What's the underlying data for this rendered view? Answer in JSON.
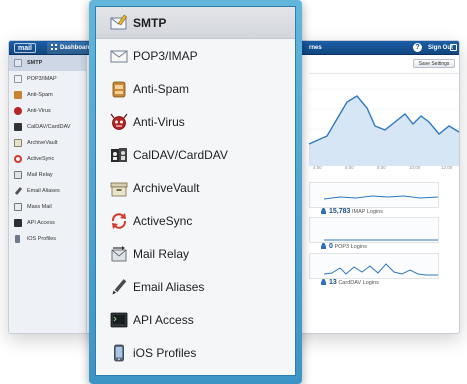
{
  "app": {
    "logo": "mail",
    "top_tab": "Dashboard",
    "top_right_partial": "rnes",
    "help_icon": "?",
    "signout": "Sign Out"
  },
  "sidebar": {
    "items": [
      {
        "label": "SMTP",
        "icon": "envelope-pencil-icon"
      },
      {
        "label": "POP3/IMAP",
        "icon": "envelope-icon"
      },
      {
        "label": "Anti-Spam",
        "icon": "spam-icon"
      },
      {
        "label": "Anti-Virus",
        "icon": "virus-icon"
      },
      {
        "label": "CalDAV/CardDAV",
        "icon": "calendar-contacts-icon"
      },
      {
        "label": "ArchiveVault",
        "icon": "archive-box-icon"
      },
      {
        "label": "ActiveSync",
        "icon": "sync-icon"
      },
      {
        "label": "Mail Relay",
        "icon": "mail-relay-icon"
      },
      {
        "label": "Email Aliases",
        "icon": "pencil-icon"
      },
      {
        "label": "Mass Mail",
        "icon": "mass-mail-icon"
      },
      {
        "label": "API Access",
        "icon": "terminal-icon"
      },
      {
        "label": "iOS Profiles",
        "icon": "phone-icon"
      }
    ]
  },
  "content": {
    "save_button": "Save Settings",
    "stats": [
      {
        "value": "15,783",
        "label": "IMAP Logins"
      },
      {
        "value": "0",
        "label": "POP3 Logins"
      },
      {
        "value": "13",
        "label": "CardDAV Logins"
      }
    ],
    "x_ticks": [
      "4:00",
      "6:00",
      "8:00",
      "10:00",
      "12:00"
    ]
  },
  "menu": {
    "selected_index": 0,
    "items": [
      {
        "label": "SMTP",
        "icon": "envelope-pencil-icon"
      },
      {
        "label": "POP3/IMAP",
        "icon": "envelope-icon"
      },
      {
        "label": "Anti-Spam",
        "icon": "spam-icon"
      },
      {
        "label": "Anti-Virus",
        "icon": "virus-icon"
      },
      {
        "label": "CalDAV/CardDAV",
        "icon": "calendar-contacts-icon"
      },
      {
        "label": "ArchiveVault",
        "icon": "archive-box-icon"
      },
      {
        "label": "ActiveSync",
        "icon": "sync-icon"
      },
      {
        "label": "Mail Relay",
        "icon": "mail-relay-icon"
      },
      {
        "label": "Email Aliases",
        "icon": "pencil-icon"
      },
      {
        "label": "API Access",
        "icon": "terminal-icon"
      },
      {
        "label": "iOS Profiles",
        "icon": "phone-icon"
      }
    ]
  },
  "colors": {
    "panel_border": "#3c95c6",
    "topbar": "#1b5ea8",
    "chart_line": "#2e78c2"
  }
}
